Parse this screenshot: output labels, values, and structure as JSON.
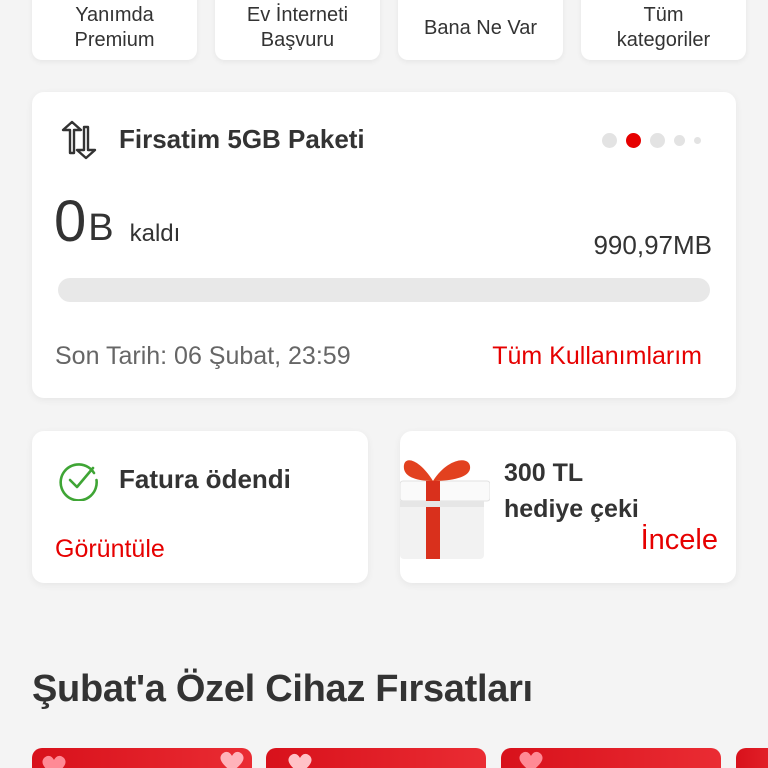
{
  "quick_links": [
    {
      "label": "Yanımda\nPremium"
    },
    {
      "label": "Ev İnterneti\nBaşvuru"
    },
    {
      "label": "Bana Ne Var"
    },
    {
      "label": "Tüm\nkategoriler"
    }
  ],
  "package": {
    "title": "Firsatim 5GB Paketi",
    "remaining_value": "0",
    "remaining_unit": "B",
    "remaining_suffix": "kaldı",
    "total": "990,97MB",
    "usage_fraction": 0,
    "deadline": "Son Tarih: 06 Şubat, 23:59",
    "usage_link": "Tüm Kullanımlarım",
    "carousel_active_index": 1,
    "carousel_count": 5
  },
  "bill": {
    "title": "Fatura ödendi",
    "link": "Görüntüle"
  },
  "gift": {
    "title_line1": "300 TL",
    "title_line2": "hediye çeki",
    "link": "İncele"
  },
  "section": {
    "title": "Şubat'a Özel Cihaz Fırsatları"
  },
  "colors": {
    "accent": "#e60000",
    "background": "#f4f4f4",
    "card": "#ffffff",
    "success": "#3fa535"
  },
  "icons": [
    "data-transfer-icon",
    "check-circle-icon",
    "gift-box-icon",
    "heart-icon"
  ]
}
